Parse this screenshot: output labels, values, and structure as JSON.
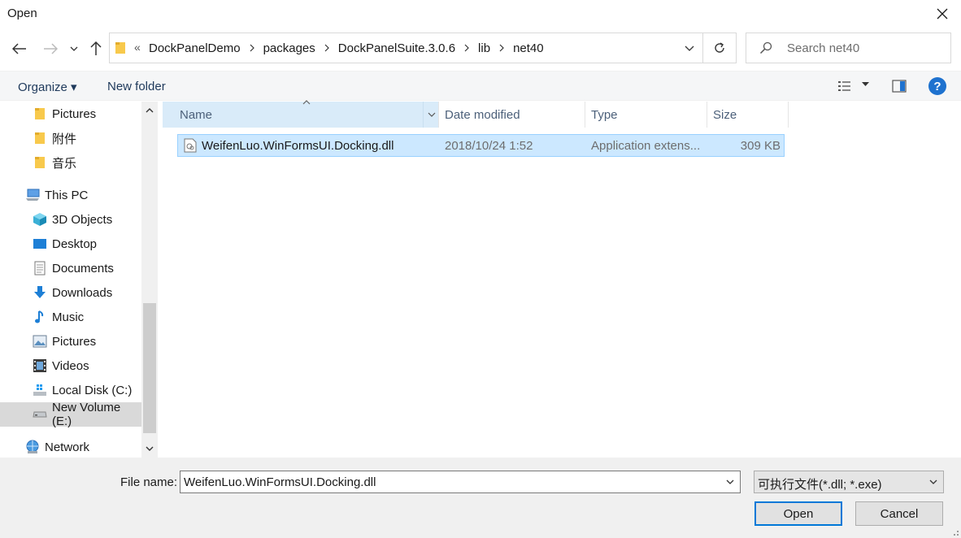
{
  "window": {
    "title": "Open"
  },
  "address": {
    "overflow": "«",
    "crumbs": [
      "DockPanelDemo",
      "packages",
      "DockPanelSuite.3.0.6",
      "lib",
      "net40"
    ]
  },
  "search": {
    "placeholder": "Search net40"
  },
  "toolbar": {
    "organize": "Organize ▾",
    "new_folder": "New folder",
    "help": "?"
  },
  "nav": {
    "items": [
      {
        "label": "Pictures",
        "icon": "folder-icon"
      },
      {
        "label": "附件",
        "icon": "folder-icon"
      },
      {
        "label": "音乐",
        "icon": "folder-icon"
      },
      {
        "label": "This PC",
        "icon": "computer-icon"
      },
      {
        "label": "3D Objects",
        "icon": "cube-icon"
      },
      {
        "label": "Desktop",
        "icon": "desktop-icon"
      },
      {
        "label": "Documents",
        "icon": "document-icon"
      },
      {
        "label": "Downloads",
        "icon": "download-arrow-icon"
      },
      {
        "label": "Music",
        "icon": "music-note-icon"
      },
      {
        "label": "Pictures",
        "icon": "picture-icon"
      },
      {
        "label": "Videos",
        "icon": "film-icon"
      },
      {
        "label": "Local Disk (C:)",
        "icon": "windows-drive-icon"
      },
      {
        "label": "New Volume (E:)",
        "icon": "drive-icon"
      },
      {
        "label": "Network",
        "icon": "network-icon"
      }
    ]
  },
  "columns": {
    "name": "Name",
    "date": "Date modified",
    "type": "Type",
    "size": "Size"
  },
  "files": [
    {
      "name": "WeifenLuo.WinFormsUI.Docking.dll",
      "date": "2018/10/24 1:52",
      "type": "Application extens...",
      "size": "309 KB"
    }
  ],
  "footer": {
    "file_name_label": "File name:",
    "file_name_value": "WeifenLuo.WinFormsUI.Docking.dll",
    "filter": "可执行文件(*.dll; *.exe)",
    "open": "Open",
    "cancel": "Cancel"
  },
  "colors": {
    "accent": "#0078d7",
    "selection": "#cce8ff",
    "header_sort": "#d9ebf9",
    "folder": "#f8c94c"
  }
}
